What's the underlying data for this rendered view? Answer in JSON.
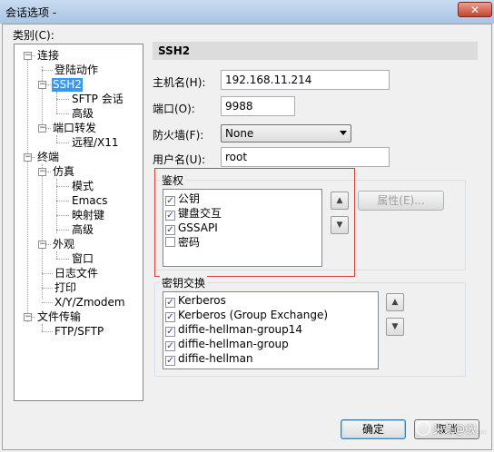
{
  "window": {
    "title": "会话选项 -",
    "close_label": "✕"
  },
  "sidebar": {
    "label": "类别(C):",
    "items": [
      {
        "label": "连接"
      },
      {
        "label": "登陆动作"
      },
      {
        "label": "SSH2"
      },
      {
        "label": "SFTP 会话"
      },
      {
        "label": "高级"
      },
      {
        "label": "端口转发"
      },
      {
        "label": "远程/X11"
      },
      {
        "label": "终端"
      },
      {
        "label": "仿真"
      },
      {
        "label": "模式"
      },
      {
        "label": "Emacs"
      },
      {
        "label": "映射键"
      },
      {
        "label": "高级"
      },
      {
        "label": "外观"
      },
      {
        "label": "窗口"
      },
      {
        "label": "日志文件"
      },
      {
        "label": "打印"
      },
      {
        "label": "X/Y/Zmodem"
      },
      {
        "label": "文件传输"
      },
      {
        "label": "FTP/SFTP"
      }
    ],
    "selected": "SSH2"
  },
  "panel": {
    "header": "SSH2"
  },
  "form": {
    "hostname_label": "主机名(H):",
    "hostname_value": "192.168.11.214",
    "port_label": "端口(O):",
    "port_value": "9988",
    "firewall_label": "防火墙(F):",
    "firewall_value": "None",
    "username_label": "用户名(U):",
    "username_value": "root"
  },
  "auth": {
    "title": "鉴权",
    "items": [
      {
        "label": "公钥",
        "checked": true
      },
      {
        "label": "键盘交互",
        "checked": true
      },
      {
        "label": "GSSAPI",
        "checked": true
      },
      {
        "label": "密码",
        "checked": false
      }
    ],
    "properties_label": "属性(E)..."
  },
  "kex": {
    "title": "密钥交换",
    "items": [
      {
        "label": "Kerberos",
        "checked": true
      },
      {
        "label": "Kerberos (Group Exchange)",
        "checked": true
      },
      {
        "label": "diffie-hellman-group14",
        "checked": true
      },
      {
        "label": "diffie-hellman-group",
        "checked": true
      },
      {
        "label": "diffie-hellman",
        "checked": true
      }
    ]
  },
  "footer": {
    "ok_label": "确定",
    "cancel_label": "取消"
  },
  "watermark": {
    "text": "头条@嵌..."
  },
  "colors": {
    "selection": "#3399ff",
    "highlight": "#d9403a"
  }
}
